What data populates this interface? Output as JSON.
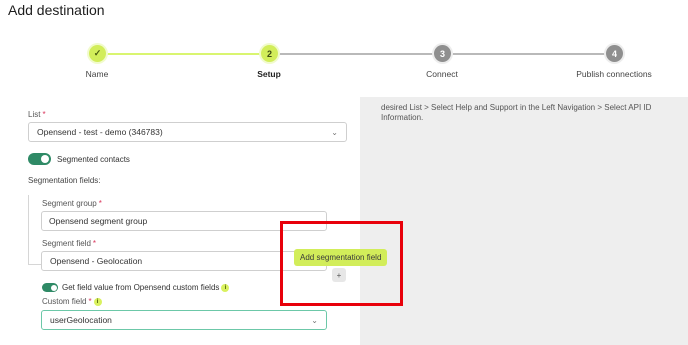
{
  "page": {
    "title": "Add destination"
  },
  "stepper": {
    "steps": [
      {
        "number": "",
        "label": "Name",
        "state": "done"
      },
      {
        "number": "2",
        "label": "Setup",
        "state": "current"
      },
      {
        "number": "3",
        "label": "Connect",
        "state": "pending"
      },
      {
        "number": "4",
        "label": "Publish connections",
        "state": "pending"
      }
    ]
  },
  "help_panel": {
    "text": "desired List > Select Help and Support in the Left Navigation > Select API ID Information."
  },
  "form": {
    "list": {
      "label": "List",
      "required_mark": "*",
      "value": "Opensend - test - demo (346783)"
    },
    "segmented_toggle": {
      "label": "Segmented contacts",
      "on": true
    },
    "segmentation_fields_label": "Segmentation fields:",
    "segment_group": {
      "label": "Segment group",
      "required_mark": "*",
      "value": "Opensend segment group"
    },
    "segment_field": {
      "label": "Segment field",
      "required_mark": "*",
      "value": "Opensend - Geolocation"
    },
    "custom_toggle": {
      "label": "Get field value from Opensend custom fields",
      "on": true,
      "info": "i"
    },
    "custom_field": {
      "label": "Custom field",
      "required_mark": "*",
      "info": "i",
      "value": "userGeolocation"
    }
  },
  "tooltip": {
    "text": "Add segmentation field"
  },
  "add_button": {
    "symbol": "+"
  },
  "colors": {
    "accent": "#d2ed5a",
    "toggle_on": "#2f8a66",
    "highlight": "#e8000a",
    "required": "#d9365c"
  }
}
